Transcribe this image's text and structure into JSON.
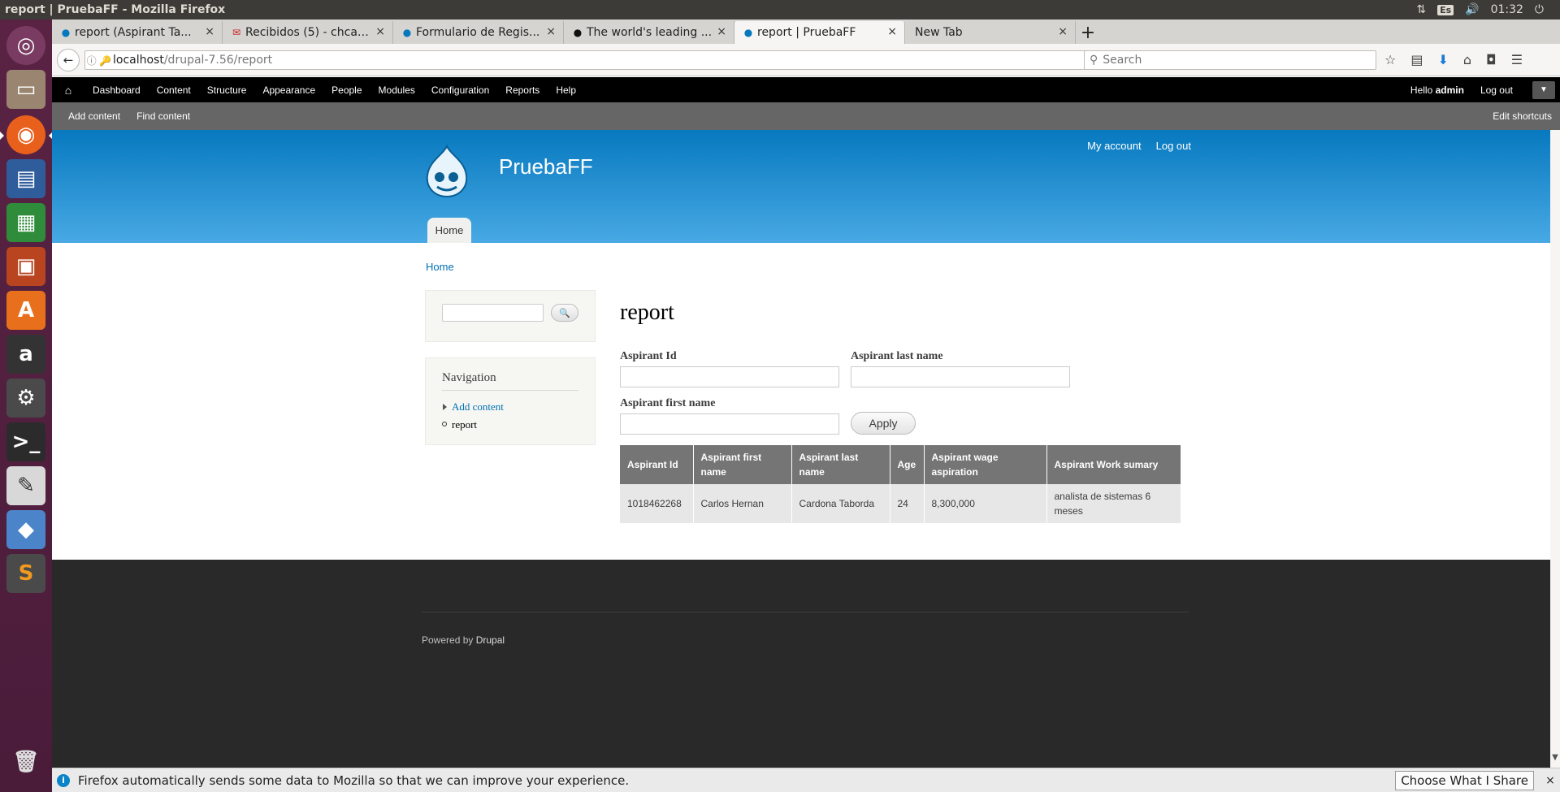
{
  "os": {
    "window_title": "report | PruebaFF - Mozilla Firefox",
    "lang": "Es",
    "time": "01:32"
  },
  "browser": {
    "tabs": [
      {
        "label": "report (Aspirant Ta...",
        "icon": "drupal-icon",
        "close": "×"
      },
      {
        "label": "Recibidos (5) - chcar...",
        "icon": "gmail-icon",
        "close": "×"
      },
      {
        "label": "Formulario de Regis...",
        "icon": "drupal-icon",
        "close": "×"
      },
      {
        "label": "The world's leading ...",
        "icon": "github-icon",
        "close": "×"
      },
      {
        "label": "report | PruebaFF",
        "icon": "drupal-icon",
        "close": "×"
      },
      {
        "label": "New Tab",
        "icon": "",
        "close": "×"
      }
    ],
    "new_tab": "+",
    "url_host": "localhost",
    "url_path": "/drupal-7.56/report",
    "search_placeholder": "Search"
  },
  "admin_toolbar": {
    "items": [
      "Dashboard",
      "Content",
      "Structure",
      "Appearance",
      "People",
      "Modules",
      "Configuration",
      "Reports",
      "Help"
    ],
    "hello": "Hello",
    "user": "admin",
    "logout": "Log out"
  },
  "shortcuts": {
    "add_content": "Add content",
    "find_content": "Find content",
    "edit_shortcuts": "Edit shortcuts"
  },
  "site": {
    "name": "PruebaFF",
    "my_account": "My account",
    "logout": "Log out",
    "main_menu_home": "Home"
  },
  "breadcrumb": "Home",
  "sidebar": {
    "navigation_title": "Navigation",
    "nav_items": [
      {
        "label": "Add content"
      },
      {
        "label": "report"
      }
    ]
  },
  "page": {
    "title": "report",
    "filters": {
      "aspirant_id_label": "Aspirant Id",
      "aspirant_last_name_label": "Aspirant last name",
      "aspirant_first_name_label": "Aspirant first name",
      "apply_label": "Apply"
    },
    "table": {
      "headers": [
        "Aspirant Id",
        "Aspirant first name",
        "Aspirant last name",
        "Age",
        "Aspirant wage aspiration",
        "Aspirant Work sumary"
      ],
      "rows": [
        [
          "1018462268",
          "Carlos Hernan",
          "Cardona Taborda",
          "24",
          "8,300,000",
          "analista de sistemas 6 meses"
        ]
      ]
    }
  },
  "footer": {
    "powered_by": "Powered by ",
    "drupal": "Drupal"
  },
  "notification": {
    "message": "Firefox automatically sends some data to Mozilla so that we can improve your experience.",
    "button": "Choose What I Share",
    "close": "×"
  },
  "colors": {
    "header_top": "#0779bf",
    "header_bottom": "#48a9e4",
    "link": "#0071b3",
    "footer_bg": "#292929",
    "launcher_bg": "#5a2344"
  }
}
